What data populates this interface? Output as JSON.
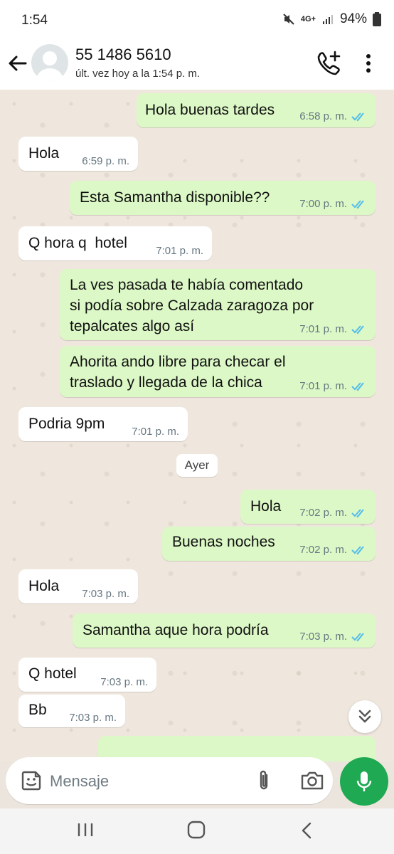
{
  "status_bar": {
    "time": "1:54",
    "network": "4G+",
    "battery": "94%"
  },
  "header": {
    "contact_name": "55 1486 5610",
    "last_seen": "últ. vez hoy a la 1:54 p. m."
  },
  "messages": [
    {
      "text": "Hola buenas tardes",
      "time": "6:58 p. m.",
      "direction": "out"
    },
    {
      "text": "Hola",
      "time": "6:59 p. m.",
      "direction": "in"
    },
    {
      "text": "Esta Samantha disponible??",
      "time": "7:00 p. m.",
      "direction": "out"
    },
    {
      "text": "Q hora q  hotel",
      "time": "7:01 p. m.",
      "direction": "in"
    },
    {
      "text": "La ves pasada te había comentado\nsi podía sobre Calzada zaragoza por\ntepalcates algo así",
      "time": "7:01 p. m.",
      "direction": "out"
    },
    {
      "text": "Ahorita ando libre para checar el\ntraslado y llegada de la chica",
      "time": "7:01 p. m.",
      "direction": "out"
    },
    {
      "text": "Podria 9pm",
      "time": "7:01 p. m.",
      "direction": "in"
    },
    {
      "text": "Hola",
      "time": "7:02 p. m.",
      "direction": "out"
    },
    {
      "text": "Buenas noches",
      "time": "7:02 p. m.",
      "direction": "out"
    },
    {
      "text": "Hola",
      "time": "7:03 p. m.",
      "direction": "in"
    },
    {
      "text": "Samantha aque hora podría",
      "time": "7:03 p. m.",
      "direction": "out"
    },
    {
      "text": "Q hotel",
      "time": "7:03 p. m.",
      "direction": "in"
    },
    {
      "text": "Bb",
      "time": "7:03 p. m.",
      "direction": "in"
    }
  ],
  "day_separator": "Ayer",
  "input": {
    "placeholder": "Mensaje"
  },
  "colors": {
    "outgoing": "#dcf8c6",
    "incoming": "#ffffff",
    "read_ticks": "#53bdeb",
    "mic": "#1ea952"
  },
  "icons": [
    "back-arrow-icon",
    "avatar-icon",
    "add-call-icon",
    "more-vert-icon",
    "emoji-icon",
    "attach-icon",
    "camera-icon",
    "mic-icon",
    "chevron-double-down-icon"
  ]
}
